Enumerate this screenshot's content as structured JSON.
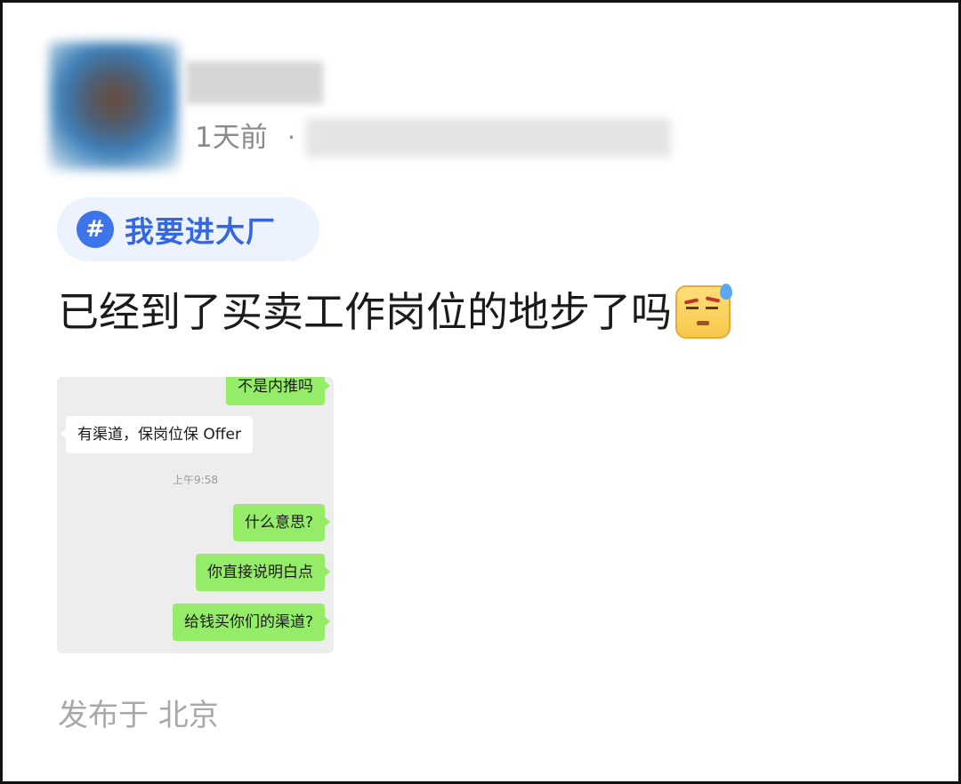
{
  "post": {
    "time_ago": "1天前",
    "separator": "·",
    "topic": {
      "icon": "hashtag-icon",
      "icon_glyph": "#",
      "label": "我要进大厂"
    },
    "text": "已经到了买卖工作岗位的地步了吗",
    "text_emoji": "sweat-annoyed-emoji",
    "location": "发布于 北京"
  },
  "chat_screenshot": {
    "messages": [
      {
        "side": "me",
        "text": "不是内推吗"
      },
      {
        "side": "them",
        "text": "有渠道，保岗位保 Offer"
      },
      {
        "side": "me",
        "text": "什么意思?"
      },
      {
        "side": "me",
        "text": "你直接说明白点"
      },
      {
        "side": "me",
        "text": "给钱买你们的渠道?"
      }
    ],
    "timestamp": "上午9:58"
  },
  "colors": {
    "topic_accent": "#3568e0",
    "topic_bg": "#edf2ff",
    "my_bubble": "#95ec69",
    "their_bubble": "#ffffff"
  }
}
